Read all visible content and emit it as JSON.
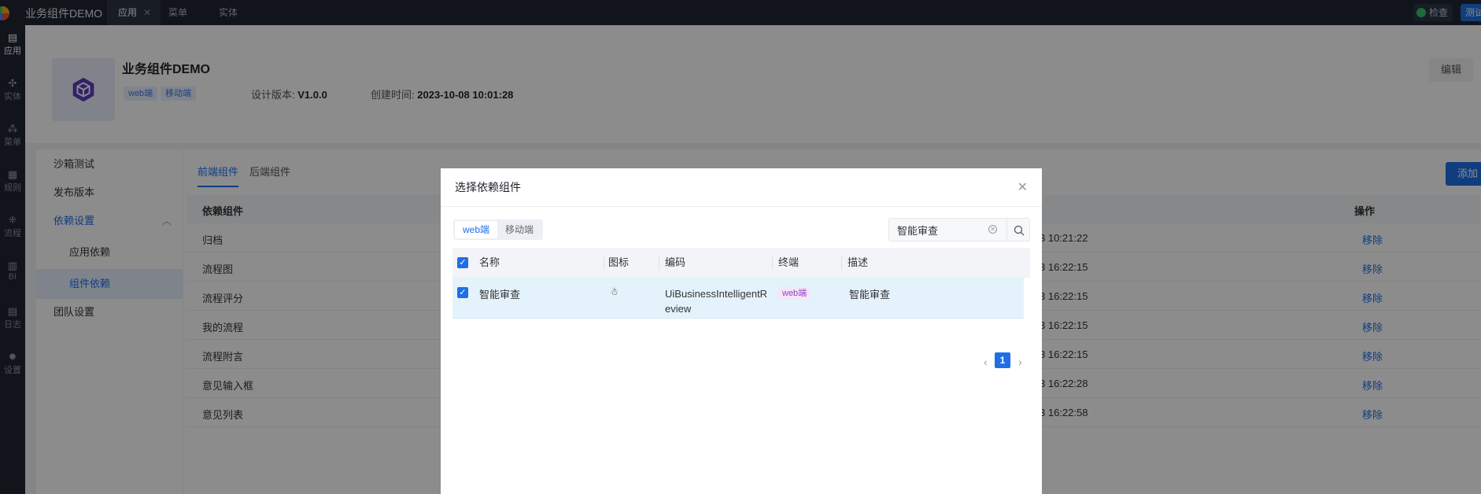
{
  "topbar": {
    "brand": "业务组件DEMO",
    "tabs": [
      "应用",
      "菜单",
      "实体"
    ],
    "check_label": "检查",
    "test_label": "测试"
  },
  "leftnav": {
    "items": [
      {
        "icon": "clipboard-icon",
        "label": "应用"
      },
      {
        "icon": "entity-icon",
        "label": "实体"
      },
      {
        "icon": "menu-icon",
        "label": "菜单"
      },
      {
        "icon": "rule-icon",
        "label": "规则"
      },
      {
        "icon": "flow-icon",
        "label": "流程"
      },
      {
        "icon": "bi-icon",
        "label": "BI"
      },
      {
        "icon": "log-icon",
        "label": "日志"
      },
      {
        "icon": "gear-icon",
        "label": "设置"
      }
    ]
  },
  "app": {
    "name": "业务组件DEMO",
    "tags": [
      "web端",
      "移动端"
    ],
    "version_label": "设计版本:",
    "version": "V1.0.0",
    "created_label": "创建时间:",
    "created": "2023-10-08 10:01:28",
    "edit_label": "编辑"
  },
  "sidemenu": {
    "items": [
      "沙箱测试",
      "发布版本",
      "依赖设置",
      "应用依赖",
      "组件依赖",
      "团队设置"
    ]
  },
  "content": {
    "tabs": [
      "前端组件",
      "后端组件"
    ],
    "add_label": "添加",
    "columns": [
      "依赖组件",
      "操作"
    ],
    "rows": [
      {
        "name": "归档",
        "time": "3 10:21:22",
        "op": "移除"
      },
      {
        "name": "流程图",
        "time": "3 16:22:15",
        "op": "移除"
      },
      {
        "name": "流程评分",
        "time": "3 16:22:15",
        "op": "移除"
      },
      {
        "name": "我的流程",
        "time": "3 16:22:15",
        "op": "移除"
      },
      {
        "name": "流程附言",
        "time": "3 16:22:15",
        "op": "移除"
      },
      {
        "name": "意见输入框",
        "time": "3 16:22:28",
        "op": "移除"
      },
      {
        "name": "意见列表",
        "time": "3 16:22:58",
        "op": "移除"
      }
    ]
  },
  "dialog": {
    "title": "选择依赖组件",
    "segments": [
      "web端",
      "移动端"
    ],
    "search_value": "智能审查",
    "columns": [
      "名称",
      "图标",
      "编码",
      "终端",
      "描述"
    ],
    "row": {
      "name": "智能审查",
      "icon": "robot-icon",
      "code_line1": "UiBusinessIntelligentR",
      "code_line2": "eview",
      "terminal": "web端",
      "desc": "智能审查"
    },
    "page": "1"
  },
  "colors": {
    "accent": "#1e6fe6",
    "topbar": "#1f2532",
    "selected_row": "#e4f3fb",
    "terminal_tag": "#9b3ec8"
  }
}
